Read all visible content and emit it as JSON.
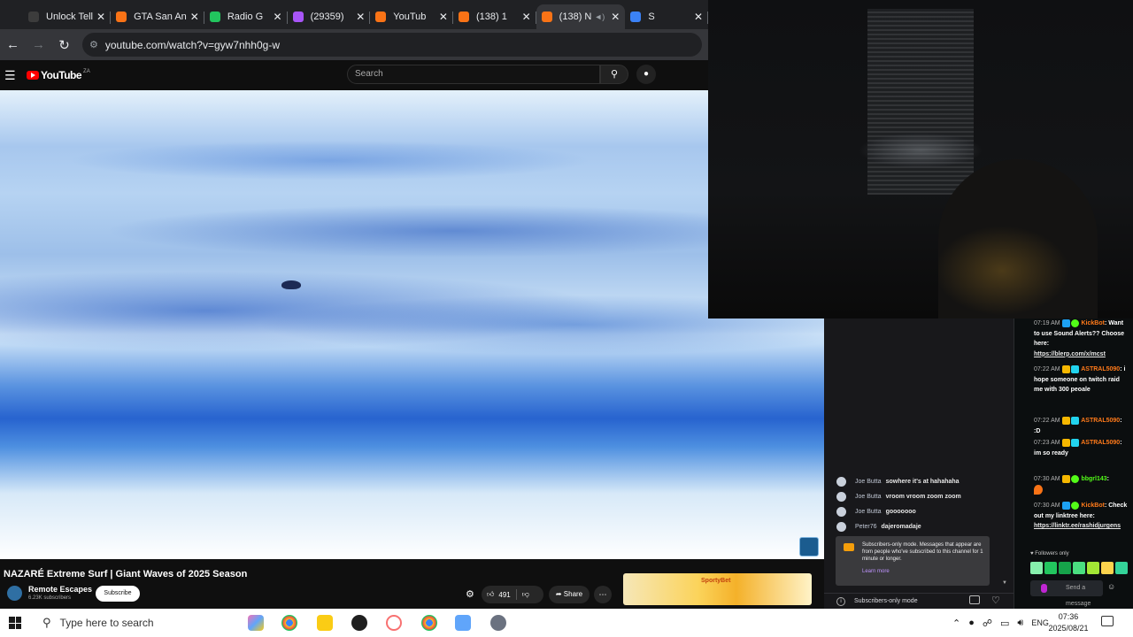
{
  "browser": {
    "tabs": [
      {
        "title": "Unlock Tell",
        "color": "#3c3c3c",
        "active": false,
        "audio": false
      },
      {
        "title": "GTA San An",
        "color": "#f97316",
        "active": false,
        "audio": false
      },
      {
        "title": "Radio G",
        "color": "#22c55e",
        "active": false,
        "audio": false
      },
      {
        "title": "(29359)",
        "color": "#a855f7",
        "active": false,
        "audio": false
      },
      {
        "title": "YouTub",
        "color": "#f97316",
        "active": false,
        "audio": false
      },
      {
        "title": "(138) 1",
        "color": "#f97316",
        "active": false,
        "audio": false
      },
      {
        "title": "(138) N",
        "color": "#f97316",
        "active": true,
        "audio": true
      },
      {
        "title": "S",
        "color": "#3b82f6",
        "active": false,
        "audio": false
      }
    ],
    "url": "youtube.com/watch?v=gyw7nhh0g-w"
  },
  "youtube": {
    "logo_text": "YouTube",
    "country_code": "ZA",
    "search_placeholder": "Search",
    "video_title": "NAZARÉ Extreme Surf | Giant Waves of 2025 Season",
    "channel_name": "Remote Escapes",
    "channel_subs": "6.23K subscribers",
    "subscribe_label": "Subscribe",
    "likes": "491",
    "share_label": "Share",
    "ad_text": "SportyBet"
  },
  "chat_left": {
    "messages": [
      {
        "user": "Joe Butta",
        "text": "sowhere it's at hahahaha"
      },
      {
        "user": "Joe Butta",
        "text": "vroom vroom zoom zoom"
      },
      {
        "user": "Joe Butta",
        "text": "gooooooo"
      },
      {
        "user": "Peter76",
        "text": "dajeromadaje"
      }
    ],
    "notice": "Subscribers-only mode. Messages that appear are from people who've subscribed to this channel for 1 minute or longer.",
    "learn_more": "Learn more",
    "footer": "Subscribers-only mode"
  },
  "chat_right": {
    "messages": [
      {
        "time": "07:19 AM",
        "user": "KickBot",
        "text": "Want to use Sound Alerts?? Choose here:",
        "link": "https://blerp.com/x/mcst"
      },
      {
        "time": "07:22 AM",
        "user": "ASTRAL5090",
        "text": "i hope someone on twitch raid me with 300 peoale",
        "link": ""
      },
      {
        "time": "07:22 AM",
        "user": "ASTRAL5090",
        "text": ":D",
        "link": ""
      },
      {
        "time": "07:23 AM",
        "user": "ASTRAL5090",
        "text": "im so ready",
        "link": ""
      },
      {
        "time": "07:30 AM",
        "user": "bbgrl143",
        "text": "",
        "link": ""
      },
      {
        "time": "07:30 AM",
        "user": "KickBot",
        "text": "Check out my linktree here:",
        "link": "https://linktr.ee/rashidjurgens"
      }
    ],
    "followers_only": "Followers only",
    "send_placeholder": "Send a message"
  },
  "taskbar": {
    "search_placeholder": "Type here to search",
    "language": "ENG",
    "time": "07:36",
    "date": "2025/08/21"
  }
}
